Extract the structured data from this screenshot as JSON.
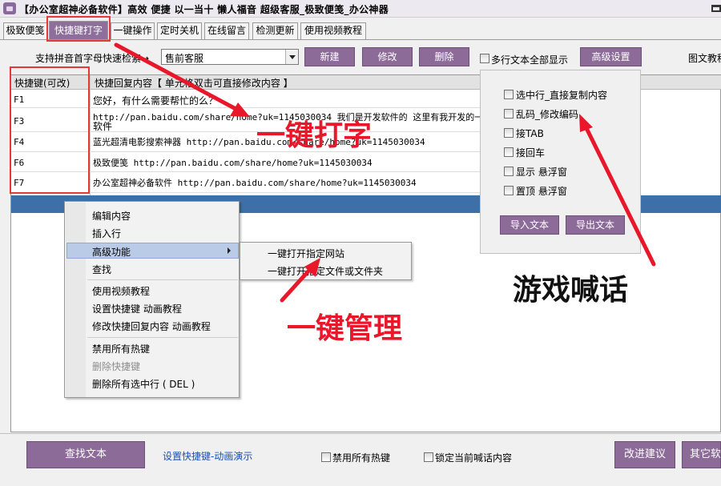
{
  "window": {
    "title": "【办公室超神必备软件】高效   便捷   以一当十   懒人福音   超级客服_极致便笺_办公神器"
  },
  "tabs": [
    {
      "label": "极致便笺",
      "active": false
    },
    {
      "label": "快捷键打字",
      "active": true
    },
    {
      "label": "一键操作",
      "active": false
    },
    {
      "label": "定时关机",
      "active": false
    },
    {
      "label": "在线留言",
      "active": false
    },
    {
      "label": "检测更新",
      "active": false
    },
    {
      "label": "使用视频教程",
      "active": false
    }
  ],
  "toolbar": {
    "pinyin_label": "支持拼音首字母快速检索→",
    "category_value": "售前客服",
    "new_label": "新建",
    "edit_label": "修改",
    "delete_label": "删除",
    "multiline_label": "多行文本全部显示",
    "advanced_label": "高级设置",
    "right_label": "图文教程"
  },
  "table": {
    "headers": {
      "key": "快捷键(可改)",
      "content": "快捷回复内容【 单元格双击可直接修改内容 】"
    },
    "rows": [
      {
        "key": "F1",
        "content": "您好，有什么需要帮忙的么？"
      },
      {
        "key": "F3",
        "content": "http://pan.baidu.com/share/home?uk=1145030034  我们是开发软件的 这里有我开发的一些",
        "content2": "软件"
      },
      {
        "key": "F4",
        "content": "蓝光超清电影搜索神器 http://pan.baidu.com/share/home?uk=1145030034"
      },
      {
        "key": "F6",
        "content": "极致便笺 http://pan.baidu.com/share/home?uk=1145030034"
      },
      {
        "key": "F7",
        "content": "办公室超神必备软件 http://pan.baidu.com/share/home?uk=1145030034"
      }
    ]
  },
  "context_menu": {
    "items": [
      "编辑内容",
      "插入行",
      "高级功能",
      "查找",
      "使用视频教程",
      "设置快捷键 动画教程",
      "修改快捷回复内容 动画教程",
      "禁用所有热键",
      "删除快捷键",
      "删除所有选中行 ( DEL )"
    ],
    "sub_items": [
      "一键打开指定网站",
      "一键打开指定文件或文件夹"
    ]
  },
  "settings_panel": {
    "options": [
      "选中行_直接复制内容",
      "乱码_修改编码",
      "接TAB",
      "接回车",
      "显示 悬浮窗",
      "置顶 悬浮窗"
    ],
    "import_label": "导入文本",
    "export_label": "导出文本"
  },
  "bottom": {
    "find_text": "查找文本",
    "demo_link": "设置快捷键-动画演示",
    "disable_hotkeys": "禁用所有热键",
    "lock_label": "锁定当前喊话内容",
    "suggest": "改进建议",
    "other": "其它软件"
  },
  "overlays": {
    "typing": "一键打字",
    "manage": "一键管理",
    "game": "游戏喊话"
  },
  "colors": {
    "accent_purple": "#8c6b99",
    "annotation_red": "#e53935",
    "selection_blue": "#3d6fa8"
  }
}
